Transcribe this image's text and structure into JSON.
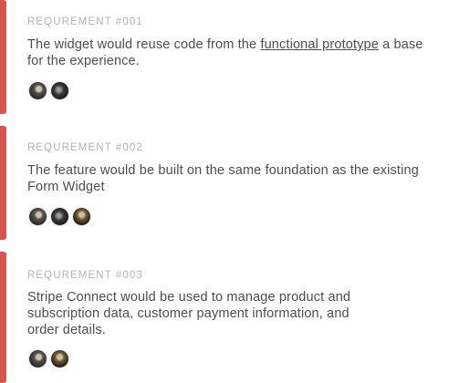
{
  "accent_color": "#d9534f",
  "requirements": [
    {
      "label": "REQUREMENT #001",
      "text_before": "The widget would reuse code from the ",
      "link_text": "functional prototype",
      "text_after": " a base for the experience.",
      "avatars": [
        "avatar-1",
        "avatar-2"
      ]
    },
    {
      "label": "REQUREMENT #002",
      "text": "The feature would be built on the same foundation as the existing Form Widget",
      "avatars": [
        "avatar-1",
        "avatar-2",
        "avatar-3"
      ]
    },
    {
      "label": "REQUREMENT #003",
      "lines": [
        "Stripe Connect would be used to manage product and",
        "subscription data, customer payment information, and",
        "order details."
      ],
      "avatars": [
        "avatar-1",
        "avatar-2"
      ]
    }
  ]
}
